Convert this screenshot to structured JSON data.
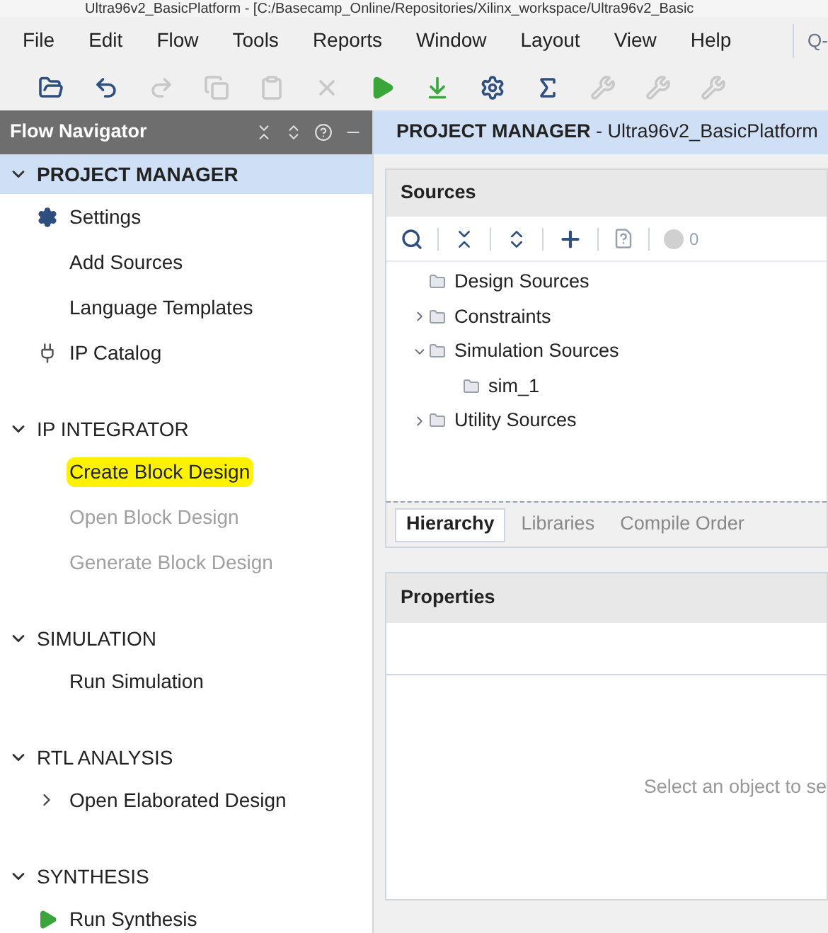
{
  "window": {
    "title": "Ultra96v2_BasicPlatform - [C:/Basecamp_Online/Repositories/Xilinx_workspace/Ultra96v2_Basic"
  },
  "menu": [
    "File",
    "Edit",
    "Flow",
    "Tools",
    "Reports",
    "Window",
    "Layout",
    "View",
    "Help"
  ],
  "search": {
    "placeholder": "Q-"
  },
  "toolbar": [
    {
      "kind": "open",
      "disabled": false
    },
    {
      "kind": "undo",
      "disabled": false
    },
    {
      "kind": "redo",
      "disabled": true
    },
    {
      "kind": "copy",
      "disabled": true
    },
    {
      "kind": "paste",
      "disabled": true
    },
    {
      "kind": "delete",
      "disabled": true
    },
    {
      "kind": "run",
      "disabled": false
    },
    {
      "kind": "program",
      "disabled": false
    },
    {
      "kind": "settings",
      "disabled": false
    },
    {
      "kind": "sigma",
      "disabled": false
    },
    {
      "kind": "tool",
      "disabled": true
    },
    {
      "kind": "tool",
      "disabled": true
    },
    {
      "kind": "tool",
      "disabled": true
    }
  ],
  "flow_navigator": {
    "title": "Flow Navigator",
    "sections": [
      {
        "title": "PROJECT MANAGER",
        "expanded": true,
        "selected": true,
        "items": [
          {
            "label": "Settings",
            "kind": "settings",
            "disabled": false,
            "highlighted": false
          },
          {
            "label": "Add Sources",
            "kind": "action",
            "disabled": false,
            "highlighted": false
          },
          {
            "label": "Language Templates",
            "kind": "action",
            "disabled": false,
            "highlighted": false
          },
          {
            "label": "IP Catalog",
            "kind": "catalog",
            "disabled": false,
            "highlighted": false
          }
        ]
      },
      {
        "title": "IP INTEGRATOR",
        "expanded": true,
        "selected": false,
        "items": [
          {
            "label": "Create Block Design",
            "kind": "action",
            "disabled": false,
            "highlighted": true
          },
          {
            "label": "Open Block Design",
            "kind": "action",
            "disabled": true,
            "highlighted": false
          },
          {
            "label": "Generate Block Design",
            "kind": "action",
            "disabled": true,
            "highlighted": false
          }
        ]
      },
      {
        "title": "SIMULATION",
        "expanded": true,
        "selected": false,
        "items": [
          {
            "label": "Run Simulation",
            "kind": "action",
            "disabled": false,
            "highlighted": false
          }
        ]
      },
      {
        "title": "RTL ANALYSIS",
        "expanded": true,
        "selected": false,
        "items": [
          {
            "label": "Open Elaborated Design",
            "kind": "submenu",
            "disabled": false,
            "highlighted": false
          }
        ]
      },
      {
        "title": "SYNTHESIS",
        "expanded": true,
        "selected": false,
        "items": [
          {
            "label": "Run Synthesis",
            "kind": "run",
            "disabled": false,
            "highlighted": false
          }
        ]
      }
    ]
  },
  "main": {
    "title": "PROJECT MANAGER",
    "subtitle": "- Ultra96v2_BasicPlatform"
  },
  "sources": {
    "title": "Sources",
    "count": "0",
    "tree": [
      {
        "label": "Design Sources"
      },
      {
        "label": "Constraints",
        "expanded": false
      },
      {
        "label": "Simulation Sources",
        "expanded": true,
        "children": [
          {
            "label": "sim_1"
          }
        ]
      },
      {
        "label": "Utility Sources",
        "expanded": false
      }
    ],
    "tabs": [
      {
        "label": "Hierarchy",
        "selected": true
      },
      {
        "label": "Libraries",
        "selected": false
      },
      {
        "label": "Compile Order",
        "selected": false
      }
    ]
  },
  "properties": {
    "title": "Properties",
    "message": "Select an object to se"
  }
}
